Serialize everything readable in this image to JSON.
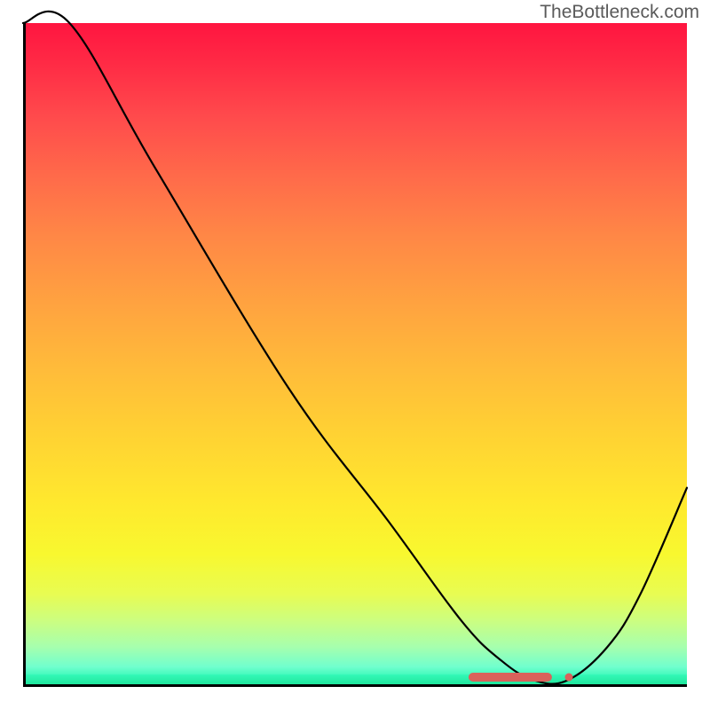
{
  "watermark": "TheBottleneck.com",
  "chart_data": {
    "type": "line",
    "title": "",
    "xlabel": "",
    "ylabel": "",
    "xlim": [
      0,
      100
    ],
    "ylim": [
      0,
      100
    ],
    "series": [
      {
        "name": "bottleneck-curve",
        "x": [
          0,
          7,
          20,
          40,
          55,
          66,
          72,
          77,
          82,
          88,
          93,
          100
        ],
        "values": [
          100,
          100,
          78,
          45,
          25,
          10,
          4,
          1,
          1,
          6,
          14,
          30
        ]
      }
    ],
    "optimum_band": {
      "x_start": 67,
      "x_end": 82,
      "bottleneck_pct": 0
    },
    "highlight_points_x": [
      67,
      70,
      73,
      76,
      79,
      82
    ]
  }
}
